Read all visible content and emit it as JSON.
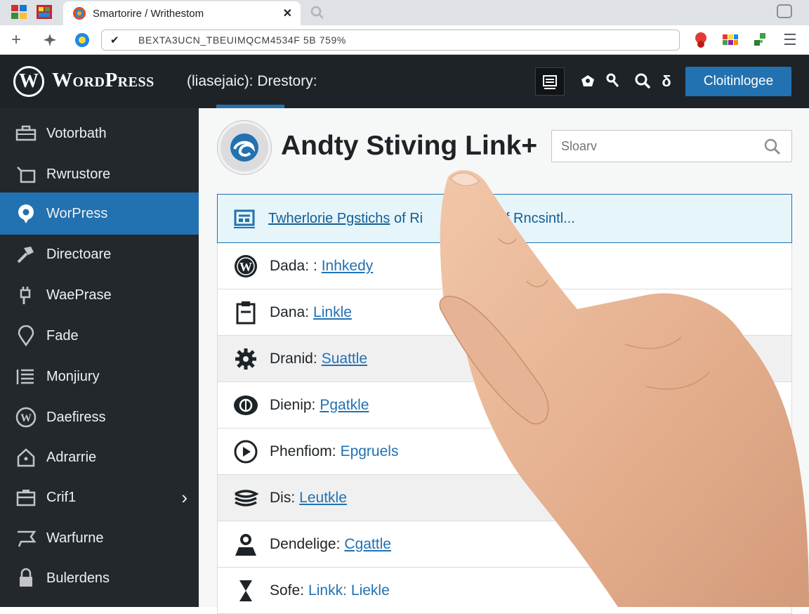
{
  "browser": {
    "tab_title": "Smartorire / Writhestom",
    "tab_close": "✕",
    "url": "BEXTA3UCN_TBEUIMQCM4534F 5B 759%"
  },
  "header": {
    "brand": "WordPress",
    "crumb": "(liasejaic): Drestory:",
    "cta_label": "Cloitinlogee",
    "btn_b_label": "δ"
  },
  "sidebar": {
    "items": [
      {
        "label": "Votorbath",
        "icon": "toolbox-icon"
      },
      {
        "label": "Rwrustore",
        "icon": "store-icon"
      },
      {
        "label": "WorPress",
        "icon": "bubble-icon",
        "active": true
      },
      {
        "label": "Directoare",
        "icon": "hammer-icon"
      },
      {
        "label": "WaePrase",
        "icon": "plug-icon"
      },
      {
        "label": "Fade",
        "icon": "pin-icon"
      },
      {
        "label": "Monjiury",
        "icon": "list-icon"
      },
      {
        "label": "Daefiress",
        "icon": "wp-icon"
      },
      {
        "label": "Adrarrie",
        "icon": "home-icon"
      },
      {
        "label": "Crif1",
        "icon": "briefcase-icon",
        "chevron": "›"
      },
      {
        "label": "Warfurne",
        "icon": "flag-icon"
      },
      {
        "label": "Bulerdens",
        "icon": "lock-icon"
      }
    ]
  },
  "main": {
    "title": "Andty Stiving Link+",
    "search_placeholder": "Sloarv",
    "banner": {
      "part1": "Twherlorie Pgstichs",
      "part2": " of Ri",
      "part3": "uks of Rncsintl..."
    },
    "rows": [
      {
        "label": "Dada: :",
        "link": "Inhkedy",
        "icon": "wordpress-icon"
      },
      {
        "label": "Dana:",
        "link": "Linkle",
        "icon": "clipboard-icon"
      },
      {
        "label": "Dranid:",
        "link": "Suattle",
        "icon": "gear-icon"
      },
      {
        "label": "Dienip:",
        "link": "Pgatkle",
        "icon": "globe-icon"
      },
      {
        "label": "Phenfiom:",
        "link": "Epgruels",
        "icon": "play-icon"
      },
      {
        "label": "Dis:",
        "link": "Leutkle",
        "icon": "layers-icon"
      },
      {
        "label": "Dendelige:",
        "link": "Cgattle",
        "icon": "person-icon"
      },
      {
        "label": "Sofe:",
        "mid": "Linkk:",
        "link": "Liekle",
        "icon": "hourglass-icon"
      }
    ]
  },
  "colors": {
    "admin_bar": "#1d2327",
    "sidebar": "#23282d",
    "accent": "#2271b1",
    "banner_bg": "#e5f5fa"
  }
}
